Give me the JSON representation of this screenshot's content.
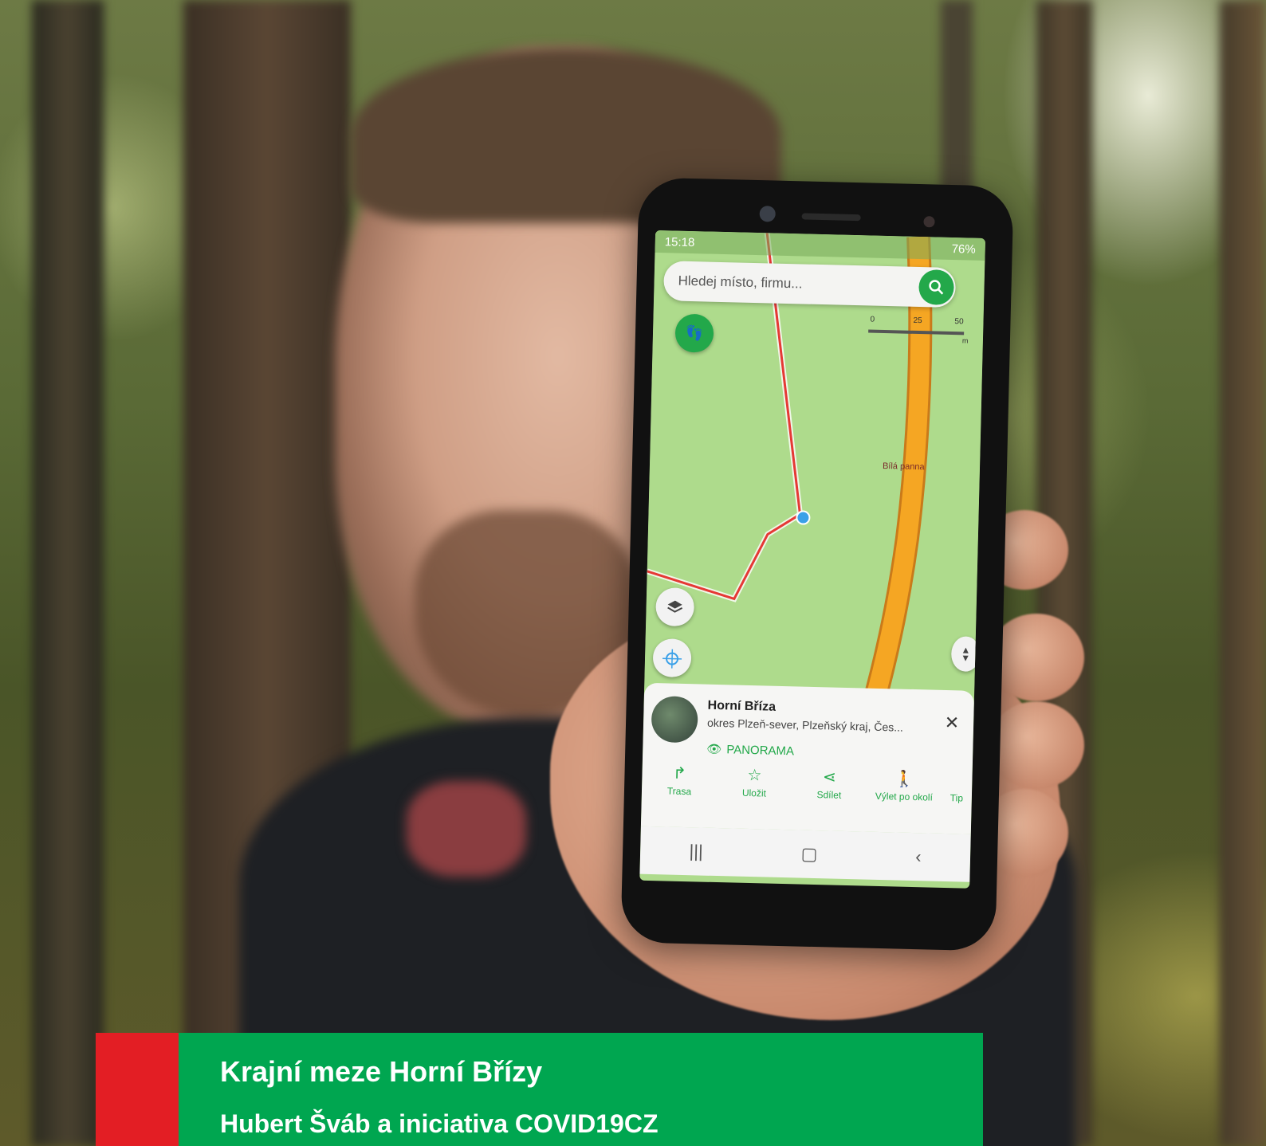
{
  "phone": {
    "status_time": "15:18",
    "battery": "76%",
    "search_placeholder": "Hledej místo, firmu...",
    "scale": {
      "s0": "0",
      "s1": "25",
      "s2": "50",
      "unit": "m"
    },
    "map_label": "Bílá panna",
    "poi": {
      "title": "Horní Bříza",
      "subtitle": "okres Plzeň-sever, Plzeňský kraj, Čes...",
      "panorama": "PANORAMA"
    },
    "actions": [
      {
        "label": "Trasa",
        "icon": "route-icon"
      },
      {
        "label": "Uložit",
        "icon": "star-icon"
      },
      {
        "label": "Sdílet",
        "icon": "share-icon"
      },
      {
        "label": "Výlet po okolí",
        "icon": "hiking-icon"
      },
      {
        "label": "Tip",
        "icon": ""
      }
    ],
    "colors": {
      "accent": "#23a84a",
      "route": "#e53935",
      "road": "#f5a623",
      "map": "#aedb8c"
    }
  },
  "caption": {
    "title": "Krajní meze Horní Břízy",
    "subtitle": "Hubert Šváb a iniciativa COVID19CZ",
    "colors": {
      "green": "#00a650",
      "red": "#e31e24"
    }
  }
}
